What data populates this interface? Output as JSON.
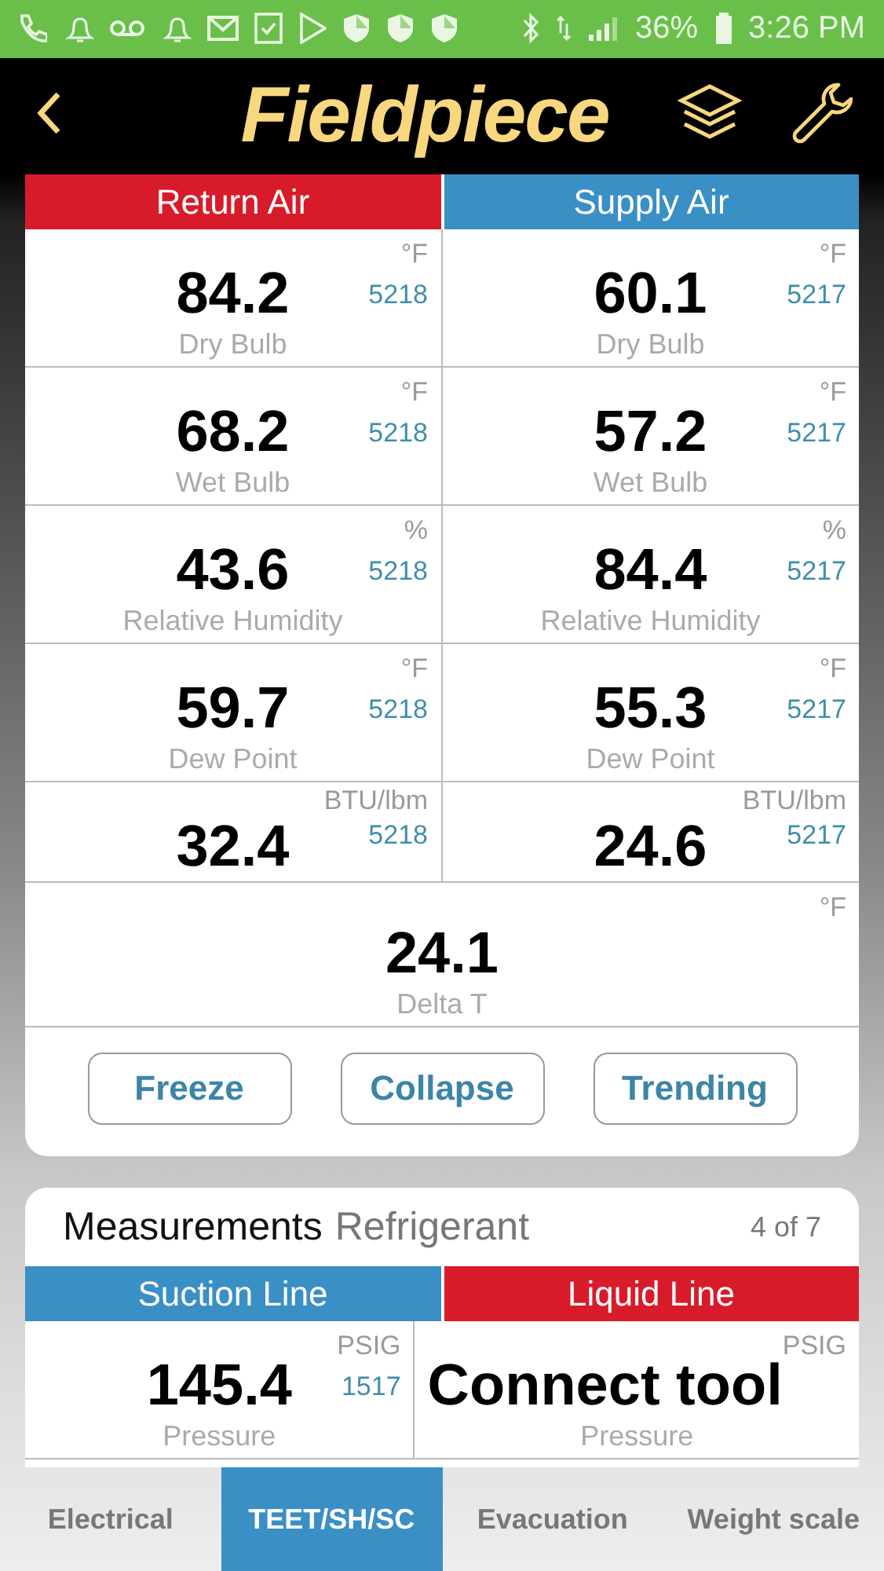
{
  "status_bar": {
    "battery": "36%",
    "time": "3:26 PM"
  },
  "header": {
    "title": "Fieldpiece"
  },
  "air_panel": {
    "columns": [
      {
        "title": "Return Air",
        "color": "#d81b2a"
      },
      {
        "title": "Supply Air",
        "color": "#3a8fc4"
      }
    ],
    "rows": [
      {
        "cells": [
          {
            "value": "84.2",
            "unit": "°F",
            "sensor": "5218",
            "label": "Dry Bulb"
          },
          {
            "value": "60.1",
            "unit": "°F",
            "sensor": "5217",
            "label": "Dry Bulb"
          }
        ]
      },
      {
        "cells": [
          {
            "value": "68.2",
            "unit": "°F",
            "sensor": "5218",
            "label": "Wet Bulb"
          },
          {
            "value": "57.2",
            "unit": "°F",
            "sensor": "5217",
            "label": "Wet Bulb"
          }
        ]
      },
      {
        "cells": [
          {
            "value": "43.6",
            "unit": "%",
            "sensor": "5218",
            "label": "Relative Humidity"
          },
          {
            "value": "84.4",
            "unit": "%",
            "sensor": "5217",
            "label": "Relative Humidity"
          }
        ]
      },
      {
        "cells": [
          {
            "value": "59.7",
            "unit": "°F",
            "sensor": "5218",
            "label": "Dew Point"
          },
          {
            "value": "55.3",
            "unit": "°F",
            "sensor": "5217",
            "label": "Dew Point"
          }
        ]
      },
      {
        "cells": [
          {
            "value": "32.4",
            "unit": "BTU/lbm",
            "sensor": "5218"
          },
          {
            "value": "24.6",
            "unit": "BTU/lbm",
            "sensor": "5217"
          }
        ]
      }
    ],
    "summary": {
      "value": "24.1",
      "unit": "°F",
      "label": "Delta T"
    },
    "buttons": [
      "Freeze",
      "Collapse",
      "Trending"
    ]
  },
  "measurements": {
    "title": "Measurements",
    "subtitle": "Refrigerant",
    "page": "4 of 7",
    "columns": [
      {
        "title": "Suction Line",
        "color": "#3a8fc4"
      },
      {
        "title": "Liquid Line",
        "color": "#d81b2a"
      }
    ],
    "rows": [
      {
        "cells": [
          {
            "value": "145.4",
            "unit": "PSIG",
            "sensor": "1517",
            "label": "Pressure"
          },
          {
            "value": "Connect tool",
            "unit": "PSIG",
            "label": "Pressure"
          }
        ]
      }
    ]
  },
  "tabs": [
    {
      "label": "Electrical",
      "selected": false
    },
    {
      "label": "TEET/SH/SC",
      "selected": true
    },
    {
      "label": "Evacuation",
      "selected": false
    },
    {
      "label": "Weight scale",
      "selected": false
    }
  ]
}
